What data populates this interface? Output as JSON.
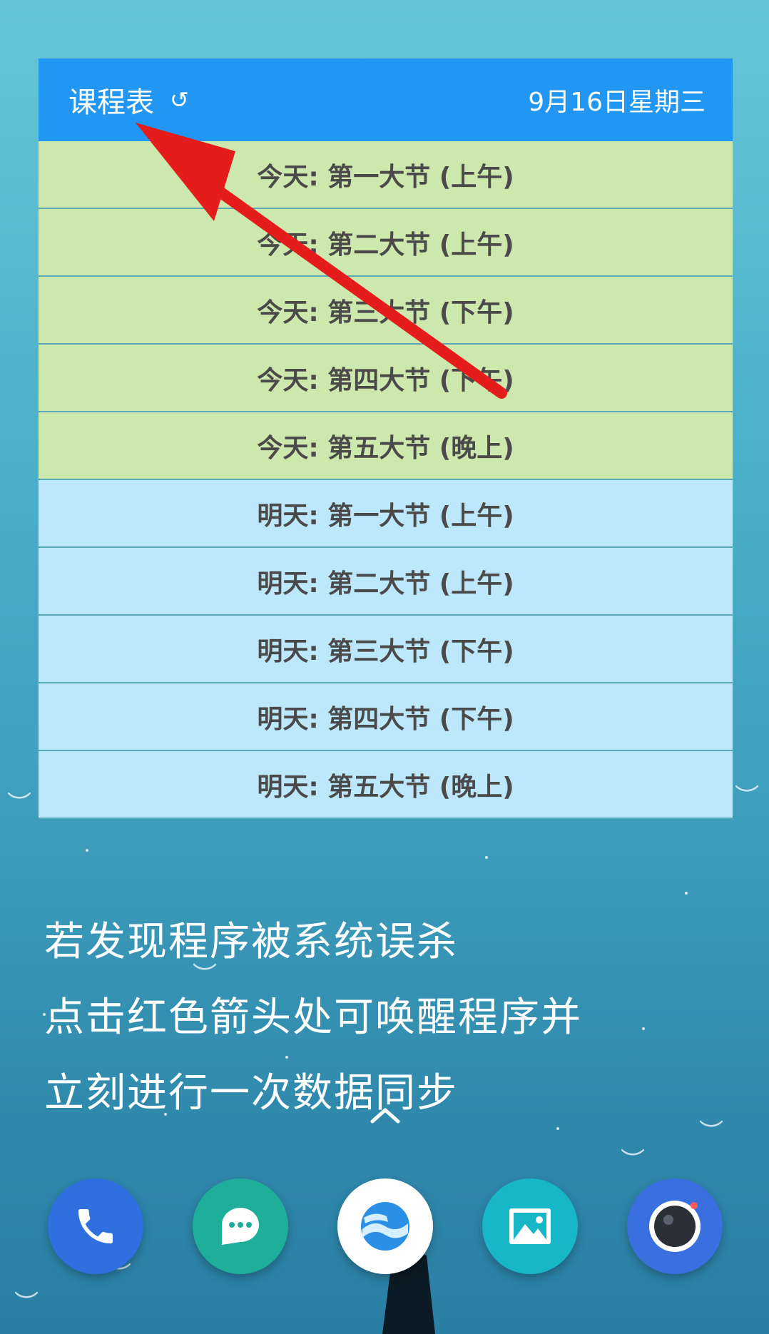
{
  "widget": {
    "title": "课程表",
    "refresh_glyph": "↺",
    "date": "9月16日星期三",
    "today_rows": [
      "今天: 第一大节 (上午)",
      "今天: 第二大节 (上午)",
      "今天: 第三大节 (下午)",
      "今天: 第四大节 (下午)",
      "今天: 第五大节 (晚上)"
    ],
    "tomorrow_rows": [
      "明天: 第一大节 (上午)",
      "明天: 第二大节 (上午)",
      "明天: 第三大节 (下午)",
      "明天: 第四大节 (下午)",
      "明天: 第五大节 (晚上)"
    ]
  },
  "notice": {
    "line1": "若发现程序被系统误杀",
    "line2": "点击红色箭头处可唤醒程序并",
    "line3": "立刻进行一次数据同步"
  },
  "dock": {
    "icons": [
      "phone-icon",
      "messages-icon",
      "browser-icon",
      "gallery-icon",
      "camera-icon"
    ]
  },
  "colors": {
    "header": "#2196f3",
    "today_row": "#cce8ac",
    "tomorrow_row": "#bde8fb",
    "annotation_arrow": "#e51c1c"
  }
}
